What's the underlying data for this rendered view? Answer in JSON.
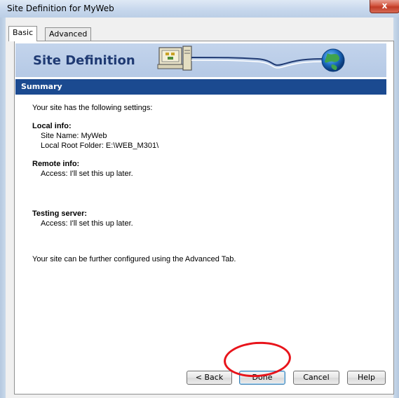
{
  "window": {
    "title": "Site Definition for MyWeb",
    "close_glyph": "x"
  },
  "tabs": [
    {
      "label": "Basic",
      "active": true
    },
    {
      "label": "Advanced",
      "active": false
    }
  ],
  "banner": {
    "title": "Site Definition",
    "art": "computer-to-globe-icon"
  },
  "summary": {
    "heading": "Summary",
    "intro": "Your site has the following settings:",
    "local": {
      "heading": "Local info:",
      "site_name": "Site Name: MyWeb",
      "root_folder": "Local Root Folder: E:\\WEB_M301\\"
    },
    "remote": {
      "heading": "Remote info:",
      "access": "Access: I'll set this up later."
    },
    "testing": {
      "heading": "Testing server:",
      "access": "Access: I'll set this up later."
    },
    "footer": "Your site can be further configured using the Advanced Tab."
  },
  "buttons": {
    "back": "< Back",
    "done": "Done",
    "cancel": "Cancel",
    "help": "Help"
  },
  "colors": {
    "banner_bg": "#b5c9e5",
    "summary_bar": "#1b4a90",
    "annotation_circle": "#e8141b"
  }
}
